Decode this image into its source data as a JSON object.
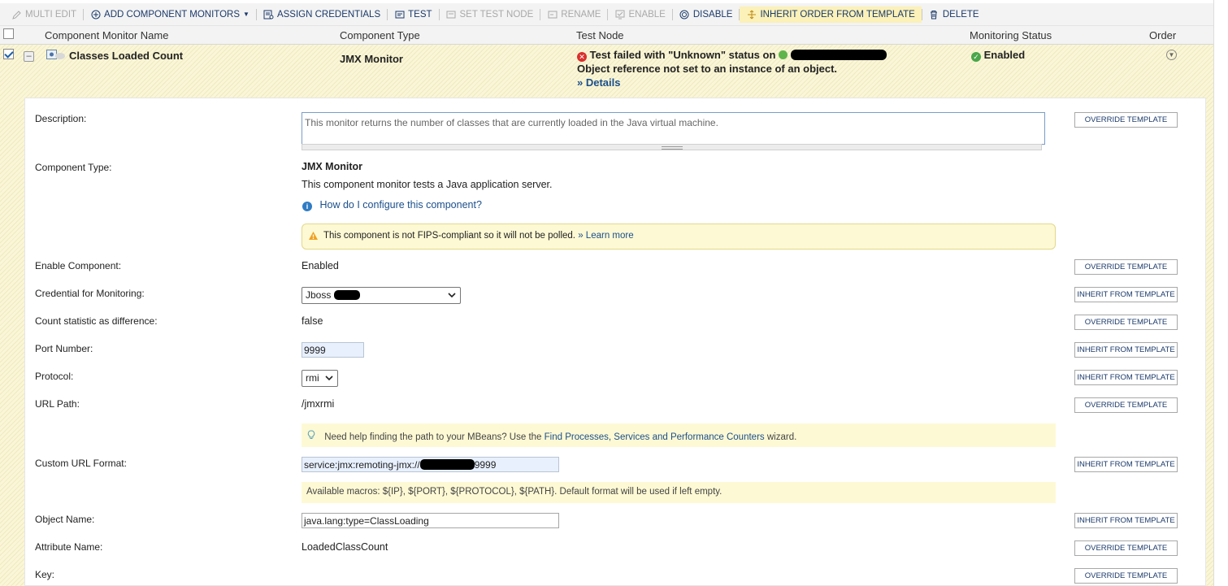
{
  "toolbar": {
    "multi_edit": "MULTI EDIT",
    "add_component_monitors": "ADD COMPONENT MONITORS",
    "assign_credentials": "ASSIGN CREDENTIALS",
    "test": "TEST",
    "set_test_node": "SET TEST NODE",
    "rename": "RENAME",
    "enable": "ENABLE",
    "disable": "DISABLE",
    "inherit_order": "INHERIT ORDER FROM TEMPLATE",
    "delete": "DELETE"
  },
  "columns": {
    "name": "Component Monitor Name",
    "type": "Component Type",
    "test_node": "Test Node",
    "status": "Monitoring Status",
    "order": "Order"
  },
  "monitor": {
    "name": "Classes Loaded Count",
    "type": "JMX Monitor",
    "test_result": "Test failed with \"Unknown\" status on",
    "test_error": "Object reference not set to an instance of an object.",
    "details_link": "» Details",
    "status": "Enabled"
  },
  "details": {
    "description_label": "Description:",
    "description_value": "This monitor returns the number of classes that are currently loaded in the Java virtual machine.",
    "component_type_label": "Component Type:",
    "component_type_name": "JMX Monitor",
    "component_type_desc": "This component monitor tests a Java application server.",
    "configure_link": "How do I configure this component?",
    "fips_warning": "This component is not FIPS-compliant so it will not be polled.",
    "learn_more": "» Learn more",
    "enable_label": "Enable Component:",
    "enable_value": "Enabled",
    "credential_label": "Credential for Monitoring:",
    "credential_value": "Jboss",
    "count_diff_label": "Count statistic as difference:",
    "count_diff_value": "false",
    "port_label": "Port Number:",
    "port_value": "9999",
    "protocol_label": "Protocol:",
    "protocol_value": "rmi",
    "url_path_label": "URL Path:",
    "url_path_value": "/jmxrmi",
    "mbeans_hint_pre": "Need help finding the path to your MBeans? Use the",
    "mbeans_hint_link": "Find Processes, Services and Performance Counters",
    "mbeans_hint_post": "wizard.",
    "custom_url_label": "Custom URL Format:",
    "custom_url_prefix": "service:jmx:remoting-jmx://",
    "custom_url_suffix": "9999",
    "macros_hint": "Available macros: ${IP}, ${PORT}, ${PROTOCOL}, ${PATH}. Default format will be used if left empty.",
    "object_name_label": "Object Name:",
    "object_name_value": "java.lang:type=ClassLoading",
    "attribute_label": "Attribute Name:",
    "attribute_value": "LoadedClassCount",
    "key_label": "Key:"
  },
  "template_buttons": {
    "override": "OVERRIDE TEMPLATE",
    "inherit": "INHERIT FROM TEMPLATE"
  },
  "colors": {
    "toolbar_bg": "#f3f3f3",
    "highlight": "#fbf1b9",
    "row_bg": "#faf6d7",
    "error": "#d9302c",
    "ok": "#4aa64a",
    "link": "#1b4f8b"
  }
}
